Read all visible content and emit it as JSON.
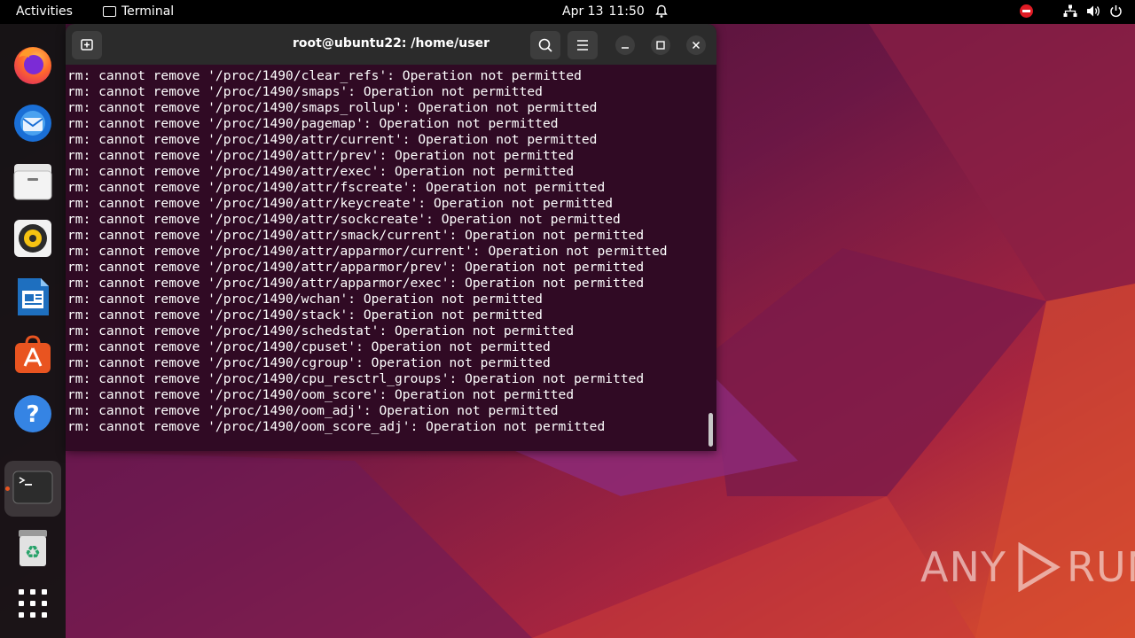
{
  "topbar": {
    "activities": "Activities",
    "app_name": "Terminal",
    "date": "Apr 13",
    "time": "11:50"
  },
  "dock": {
    "items": [
      "firefox-icon",
      "thunderbird-icon",
      "files-icon",
      "rhythmbox-icon",
      "libreoffice-writer-icon",
      "app-center-icon",
      "help-icon",
      "terminal-icon",
      "trash-icon",
      "show-apps-icon"
    ]
  },
  "window": {
    "title": "root@ubuntu22: /home/user",
    "lines": [
      "rm: cannot remove '/proc/1490/clear_refs': Operation not permitted",
      "rm: cannot remove '/proc/1490/smaps': Operation not permitted",
      "rm: cannot remove '/proc/1490/smaps_rollup': Operation not permitted",
      "rm: cannot remove '/proc/1490/pagemap': Operation not permitted",
      "rm: cannot remove '/proc/1490/attr/current': Operation not permitted",
      "rm: cannot remove '/proc/1490/attr/prev': Operation not permitted",
      "rm: cannot remove '/proc/1490/attr/exec': Operation not permitted",
      "rm: cannot remove '/proc/1490/attr/fscreate': Operation not permitted",
      "rm: cannot remove '/proc/1490/attr/keycreate': Operation not permitted",
      "rm: cannot remove '/proc/1490/attr/sockcreate': Operation not permitted",
      "rm: cannot remove '/proc/1490/attr/smack/current': Operation not permitted",
      "rm: cannot remove '/proc/1490/attr/apparmor/current': Operation not permitted",
      "rm: cannot remove '/proc/1490/attr/apparmor/prev': Operation not permitted",
      "rm: cannot remove '/proc/1490/attr/apparmor/exec': Operation not permitted",
      "rm: cannot remove '/proc/1490/wchan': Operation not permitted",
      "rm: cannot remove '/proc/1490/stack': Operation not permitted",
      "rm: cannot remove '/proc/1490/schedstat': Operation not permitted",
      "rm: cannot remove '/proc/1490/cpuset': Operation not permitted",
      "rm: cannot remove '/proc/1490/cgroup': Operation not permitted",
      "rm: cannot remove '/proc/1490/cpu_resctrl_groups': Operation not permitted",
      "rm: cannot remove '/proc/1490/oom_score': Operation not permitted",
      "rm: cannot remove '/proc/1490/oom_adj': Operation not permitted",
      "rm: cannot remove '/proc/1490/oom_score_adj': Operation not permitted"
    ]
  },
  "watermark": {
    "left": "ANY",
    "right": "RUN"
  },
  "colors": {
    "terminal_bg": "#300a24",
    "accent": "#e95420"
  }
}
